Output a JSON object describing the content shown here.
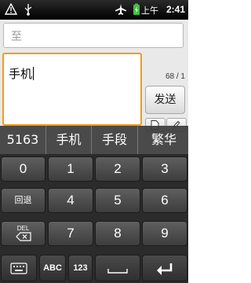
{
  "status_bar": {
    "icons": [
      "warning-icon",
      "usb-icon",
      "airplane-mode-icon",
      "battery-charging-icon"
    ],
    "ampm": "上午",
    "time": "2:41"
  },
  "recipient": {
    "placeholder": "至"
  },
  "compose": {
    "text": "手机",
    "counter": "68 / 1"
  },
  "send_button": {
    "label": "发送"
  },
  "attachment_icons": [
    "document-icon",
    "pen-icon"
  ],
  "candidates": [
    "5163",
    "手机",
    "手段",
    "繁华"
  ],
  "keyboard": {
    "digits": [
      "0",
      "1",
      "2",
      "3",
      "4",
      "5",
      "6",
      "7",
      "8",
      "9"
    ],
    "back_label": "回退",
    "delete_label": "DEL",
    "abc_label": "ABC",
    "num_label": "123"
  },
  "colors": {
    "focus_border": "#f59a14",
    "keyboard_bg": "#2b2b2b"
  }
}
